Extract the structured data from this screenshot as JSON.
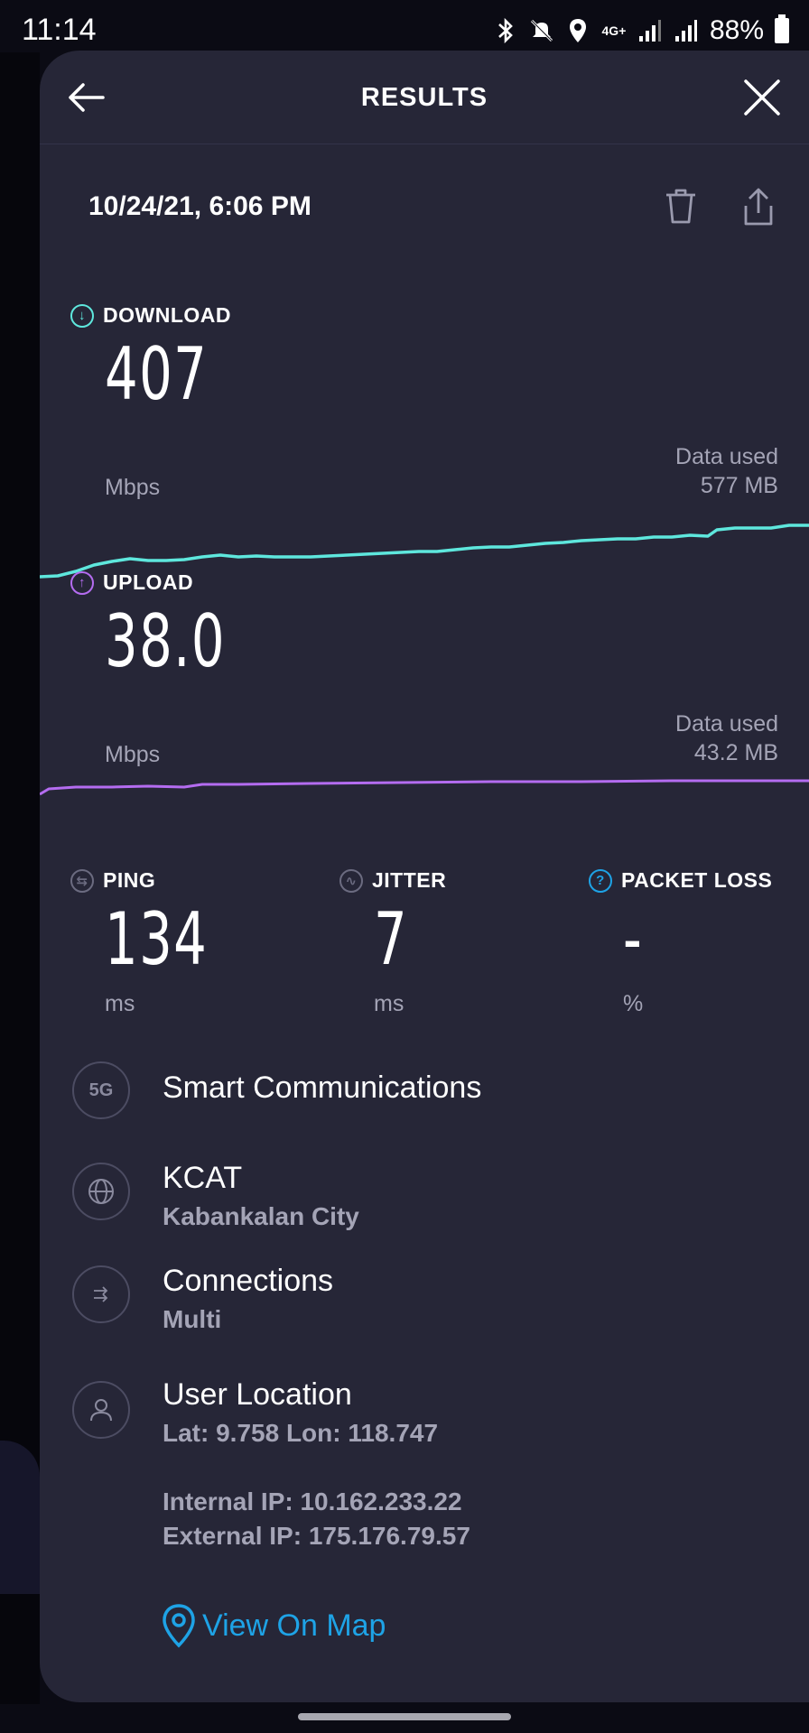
{
  "status_bar": {
    "time": "11:14",
    "network": "4G+",
    "battery": "88%"
  },
  "header": {
    "title": "RESULTS"
  },
  "result": {
    "datetime": "10/24/21, 6:06 PM"
  },
  "download": {
    "label": "DOWNLOAD",
    "value": "407",
    "unit": "Mbps",
    "data_used_label": "Data used",
    "data_used": "577 MB",
    "color": "#5ee7dd"
  },
  "upload": {
    "label": "UPLOAD",
    "value": "38.0",
    "unit": "Mbps",
    "data_used_label": "Data used",
    "data_used": "43.2 MB",
    "color": "#b46cf0"
  },
  "ping": {
    "label": "PING",
    "value": "134",
    "unit": "ms"
  },
  "jitter": {
    "label": "JITTER",
    "value": "7",
    "unit": "ms"
  },
  "packet_loss": {
    "label": "PACKET LOSS",
    "value": "-",
    "unit": "%"
  },
  "provider": {
    "badge": "5G",
    "name": "Smart Communications"
  },
  "server": {
    "name": "KCAT",
    "location": "Kabankalan City"
  },
  "connections": {
    "title": "Connections",
    "value": "Multi"
  },
  "user_location": {
    "title": "User Location",
    "coords": "Lat: 9.758 Lon: 118.747",
    "internal_ip": "Internal IP: 10.162.233.22",
    "external_ip": "External IP: 175.176.79.57"
  },
  "map_link": {
    "label": "View On Map",
    "color": "#1ea3e6"
  },
  "colors": {
    "background": "#262637",
    "secondary_text": "#a4a4b6"
  }
}
